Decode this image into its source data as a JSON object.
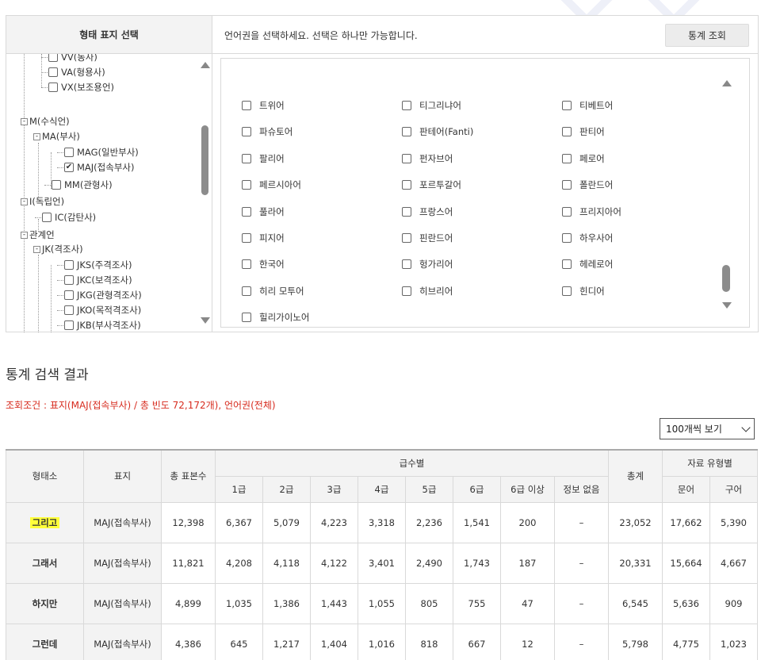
{
  "panel": {
    "left_header": "형태 표지 선택",
    "right_message": "언어권을 선택하세요. 선택은 하나만 가능합니다.",
    "stat_button": "통계 조회"
  },
  "tree": [
    {
      "label": "VV(동사)",
      "toggle": "",
      "checked": false
    },
    {
      "label": "VA(형용사)",
      "toggle": "",
      "checked": false
    },
    {
      "label": "VX(보조용언)",
      "toggle": "",
      "checked": false
    },
    {
      "label": "M(수식언)",
      "toggle": "-",
      "checked": null
    },
    {
      "label": "MA(부사)",
      "toggle": "-",
      "checked": null
    },
    {
      "label": "MAG(일반부사)",
      "toggle": "",
      "checked": false
    },
    {
      "label": "MAJ(접속부사)",
      "toggle": "",
      "checked": true
    },
    {
      "label": "MM(관형사)",
      "toggle": "",
      "checked": false
    },
    {
      "label": "I(독립언)",
      "toggle": "-",
      "checked": null
    },
    {
      "label": "IC(감탄사)",
      "toggle": "",
      "checked": false
    },
    {
      "label": "관계언",
      "toggle": "-",
      "checked": null
    },
    {
      "label": "JK(격조사)",
      "toggle": "-",
      "checked": null
    },
    {
      "label": "JKS(주격조사)",
      "toggle": "",
      "checked": false
    },
    {
      "label": "JKC(보격조사)",
      "toggle": "",
      "checked": false
    },
    {
      "label": "JKG(관형격조사)",
      "toggle": "",
      "checked": false
    },
    {
      "label": "JKO(목적격조사)",
      "toggle": "",
      "checked": false
    },
    {
      "label": "JKB(부사격조사)",
      "toggle": "",
      "checked": false
    }
  ],
  "languages": [
    [
      "트위어",
      "티그리냐어",
      "티베트어"
    ],
    [
      "파슈토어",
      "판테어(Fanti)",
      "판티어"
    ],
    [
      "팔리어",
      "펀자브어",
      "페로어"
    ],
    [
      "페르시아어",
      "포르투갈어",
      "폴란드어"
    ],
    [
      "풀라어",
      "프랑스어",
      "프리지아어"
    ],
    [
      "피지어",
      "핀란드어",
      "하우사어"
    ],
    [
      "한국어",
      "헝가리어",
      "헤레로어"
    ],
    [
      "히리 모투어",
      "히브리어",
      "힌디어"
    ],
    [
      "힐리가이노어"
    ]
  ],
  "result": {
    "title": "통계 검색 결과",
    "condition": "조회조건 : 표지(MAJ(접속부사) / 총 빈도 72,172개), 언어권(전체)",
    "per_page": "100개씩 보기"
  },
  "table": {
    "headers": {
      "morpheme": "형태소",
      "tag": "표지",
      "samples": "총 표본수",
      "grade_group": "급수별",
      "grades": [
        "1급",
        "2급",
        "3급",
        "4급",
        "5급",
        "6급",
        "6급 이상",
        "정보 없음"
      ],
      "total": "총계",
      "type_group": "자료 유형별",
      "types": [
        "문어",
        "구어"
      ]
    },
    "rows": [
      {
        "morpheme": "그리고",
        "tag": "MAJ(접속부사)",
        "samples": "12,398",
        "grades": [
          "6,367",
          "5,079",
          "4,223",
          "3,318",
          "2,236",
          "1,541",
          "200",
          "–"
        ],
        "total": "23,052",
        "types": [
          "17,662",
          "5,390"
        ]
      },
      {
        "morpheme": "그래서",
        "tag": "MAJ(접속부사)",
        "samples": "11,821",
        "grades": [
          "4,208",
          "4,118",
          "4,122",
          "3,401",
          "2,490",
          "1,743",
          "187",
          "–"
        ],
        "total": "20,331",
        "types": [
          "15,664",
          "4,667"
        ]
      },
      {
        "morpheme": "하지만",
        "tag": "MAJ(접속부사)",
        "samples": "4,899",
        "grades": [
          "1,035",
          "1,386",
          "1,443",
          "1,055",
          "805",
          "755",
          "47",
          "–"
        ],
        "total": "6,545",
        "types": [
          "5,636",
          "909"
        ]
      },
      {
        "morpheme": "그런데",
        "tag": "MAJ(접속부사)",
        "samples": "4,386",
        "grades": [
          "645",
          "1,217",
          "1,404",
          "1,016",
          "818",
          "667",
          "12",
          "–"
        ],
        "total": "5,798",
        "types": [
          "4,775",
          "1,023"
        ]
      }
    ]
  },
  "colors": {
    "condition_text": "#d72c1f",
    "highlight": "#ffff3a",
    "header_bg": "#f3f3f3"
  }
}
